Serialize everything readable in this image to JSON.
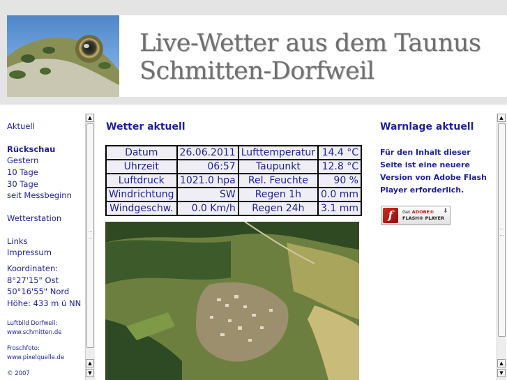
{
  "header": {
    "title_line1": "Live-Wetter aus dem Taunus",
    "title_line2": "Schmitten-Dorfweil"
  },
  "nav": {
    "aktuell": "Aktuell",
    "rueckschau": "Rückschau",
    "gestern": "Gestern",
    "zehn_tage": "10 Tage",
    "dreissig_tage": "30 Tage",
    "seit_messbeginn": "seit Messbeginn",
    "wetterstation": "Wetterstation",
    "links": "Links",
    "impressum": "Impressum",
    "koordinaten_label": "Koordinaten:",
    "ost": "8°27'15\" Ost",
    "nord": "50°16'55\" Nord",
    "hoehe": "Höhe: 433 m ü NN",
    "luftbild_label": "Luftbild Dorfweil:",
    "luftbild_url": "www.schmitten.de",
    "froschfoto_label": "Froschfoto:",
    "froschfoto_url": "www.pixelquelle.de",
    "copyright": "© 2007"
  },
  "main": {
    "title": "Wetter aktuell",
    "rows": [
      {
        "l1": "Datum",
        "v1": "26.06.2011",
        "l2": "Lufttemperatur",
        "v2": "14.4 °C"
      },
      {
        "l1": "Uhrzeit",
        "v1": "06:57",
        "l2": "Taupunkt",
        "v2": "12.8 °C"
      },
      {
        "l1": "Luftdruck",
        "v1": "1021.0 hpa",
        "l2": "Rel. Feuchte",
        "v2": "90 %"
      },
      {
        "l1": "Windrichtung",
        "v1": "SW",
        "l2": "Regen 1h",
        "v2": "0.0 mm"
      },
      {
        "l1": "Windgeschw.",
        "v1": "0.0 Km/h",
        "l2": "Regen 24h",
        "v2": "3.1 mm"
      }
    ]
  },
  "warn": {
    "title": "Warnlage aktuell",
    "text": "Für den Inhalt dieser Seite ist eine neuere Version von Adobe Flash Player erforderlich.",
    "flash_get": "Get",
    "flash_adobe": "ADOBE®",
    "flash_player": "FLASH® PLAYER"
  },
  "colors": {
    "link": "#1f1f9a",
    "table_bg": "#eeeef4",
    "header_band": "#e4e4e4"
  }
}
